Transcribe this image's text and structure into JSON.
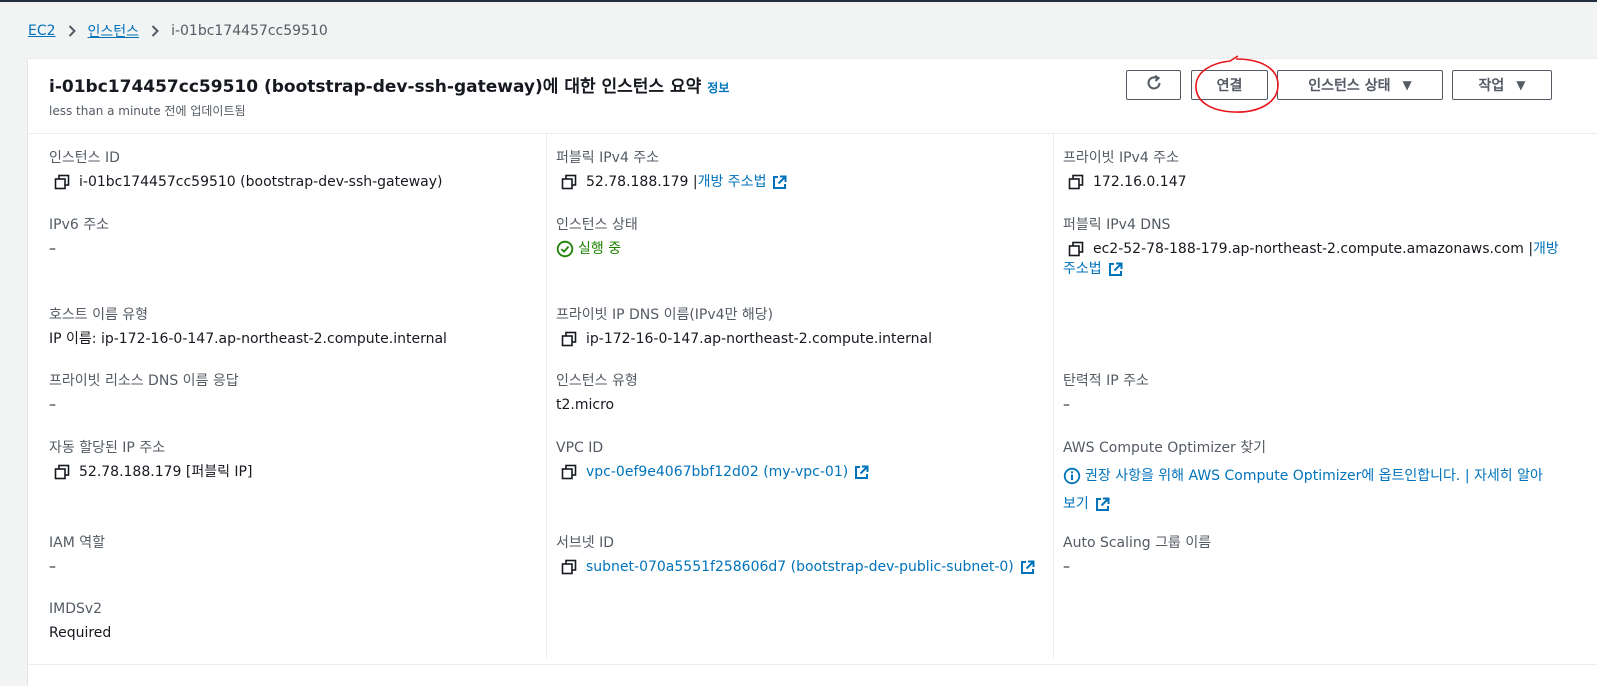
{
  "breadcrumb": {
    "items": [
      {
        "label": "EC2"
      },
      {
        "label": "인스턴스"
      }
    ],
    "current": "i-01bc174457cc59510"
  },
  "header": {
    "title": "i-01bc174457cc59510 (bootstrap-dev-ssh-gateway)에 대한 인스턴스 요약",
    "info_link": "정보",
    "subtitle": "less than a minute 전에 업데이트됨",
    "buttons": {
      "refresh_icon": "refresh-icon",
      "connect": "연결",
      "instance_state": "인스턴스 상태",
      "actions": "작업"
    },
    "annotation_color": "#e8141c"
  },
  "fields": {
    "instance_id": {
      "label": "인스턴스 ID",
      "value": "i-01bc174457cc59510 (bootstrap-dev-ssh-gateway)"
    },
    "public_ipv4": {
      "label": "퍼블릭 IPv4 주소",
      "value": "52.78.188.179 |",
      "link": "개방 주소법"
    },
    "private_ipv4": {
      "label": "프라이빗 IPv4 주소",
      "value": "172.16.0.147"
    },
    "ipv6": {
      "label": "IPv6 주소",
      "value": "–"
    },
    "instance_state": {
      "label": "인스턴스 상태",
      "value": "실행 중",
      "status_color": "#1d8102"
    },
    "public_dns": {
      "label": "퍼블릭 IPv4 DNS",
      "value": "ec2-52-78-188-179.ap-northeast-2.compute.amazonaws.com |",
      "link": "개방 주소법"
    },
    "hostname_type": {
      "label": "호스트 이름 유형",
      "value": "IP 이름: ip-172-16-0-147.ap-northeast-2.compute.internal"
    },
    "private_dns": {
      "label": "프라이빗 IP DNS 이름(IPv4만 해당)",
      "value": "ip-172-16-0-147.ap-northeast-2.compute.internal"
    },
    "resource_dns": {
      "label": "프라이빗 리소스 DNS 이름 응답",
      "value": "–"
    },
    "instance_type": {
      "label": "인스턴스 유형",
      "value": "t2.micro"
    },
    "elastic_ip": {
      "label": "탄력적 IP 주소",
      "value": "–"
    },
    "auto_ip": {
      "label": "자동 할당된 IP 주소",
      "value": "52.78.188.179 [퍼블릭 IP]"
    },
    "vpc_id": {
      "label": "VPC ID",
      "value": "vpc-0ef9e4067bbf12d02 (my-vpc-01)"
    },
    "optimizer": {
      "label": "AWS Compute Optimizer 찾기",
      "value": "권장 사항을 위해 AWS Compute Optimizer에 옵트인합니다. |",
      "link": "자세히 알아보기"
    },
    "iam_role": {
      "label": "IAM 역할",
      "value": "–"
    },
    "subnet_id": {
      "label": "서브넷 ID",
      "value": "subnet-070a5551f258606d7 (bootstrap-dev-public-subnet-0)"
    },
    "asg_name": {
      "label": "Auto Scaling 그룹 이름",
      "value": "–"
    },
    "imdsv2": {
      "label": "IMDSv2",
      "value": "Required"
    }
  },
  "colors": {
    "link": "#0073bb",
    "success": "#1d8102",
    "label": "#545b64",
    "background": "#f2f3f3"
  }
}
